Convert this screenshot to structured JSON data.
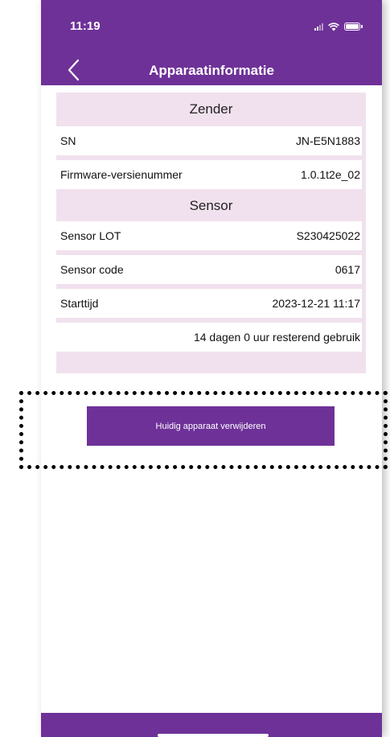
{
  "status": {
    "time": "11:19"
  },
  "nav": {
    "title": "Apparaatinformatie"
  },
  "zender": {
    "header": "Zender",
    "rows": [
      {
        "label": "SN",
        "value": "JN-E5N1883"
      },
      {
        "label": "Firmware-versienummer",
        "value": "1.0.1t2e_02"
      }
    ]
  },
  "sensor": {
    "header": "Sensor",
    "rows": [
      {
        "label": "Sensor LOT",
        "value": "S230425022"
      },
      {
        "label": "Sensor code",
        "value": "0617"
      },
      {
        "label": "Starttijd",
        "value": "2023-12-21 11:17"
      }
    ],
    "remaining": "14 dagen 0 uur resterend gebruik"
  },
  "actions": {
    "delete_label": "Huidig apparaat verwijderen"
  },
  "colors": {
    "accent": "#6e3198",
    "card_bg": "#f1e1ee",
    "highlight": "#000000"
  }
}
